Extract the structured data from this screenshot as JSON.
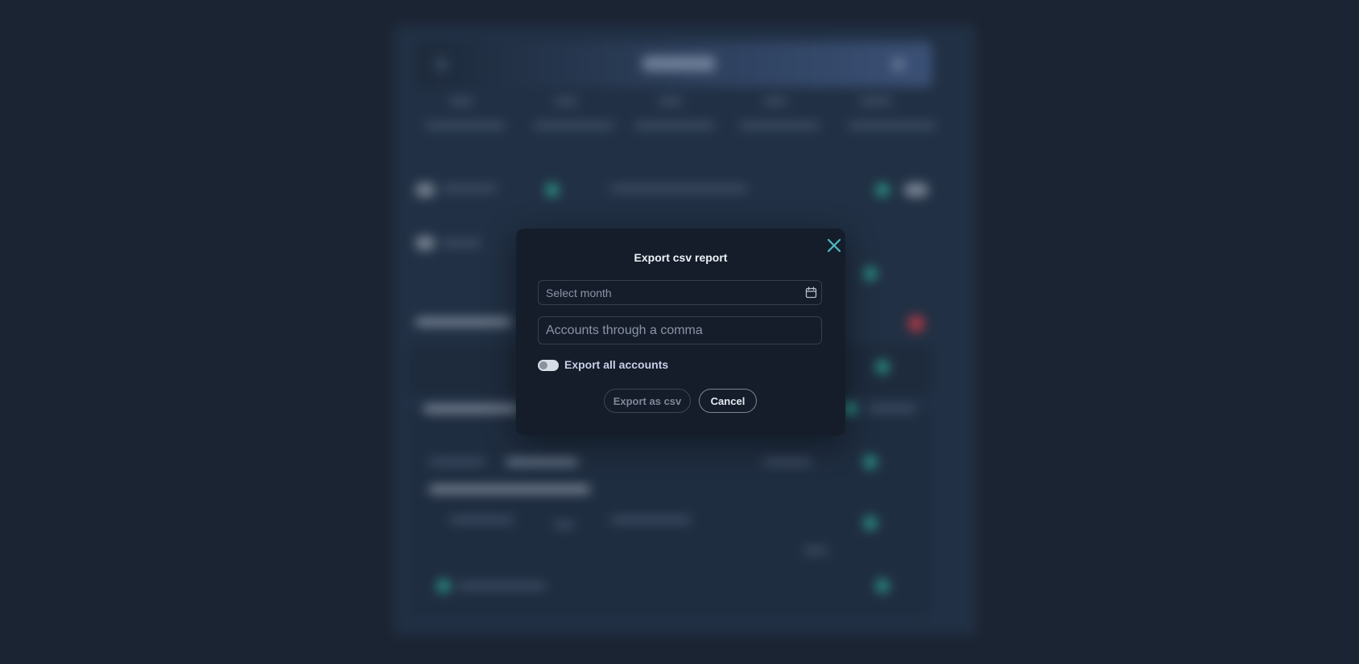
{
  "dialog": {
    "title": "Export csv report",
    "month_placeholder": "Select month",
    "accounts_placeholder": "Accounts through a comma",
    "toggle_label": "Export all accounts",
    "toggle_on": false,
    "export_label": "Export as csv",
    "cancel_label": "Cancel"
  },
  "icons": {
    "close": "close-icon",
    "calendar": "calendar-icon"
  },
  "colors": {
    "accent": "#4fb8c4",
    "modal_bg": "#151d2a",
    "page_bg": "#1b2432"
  }
}
